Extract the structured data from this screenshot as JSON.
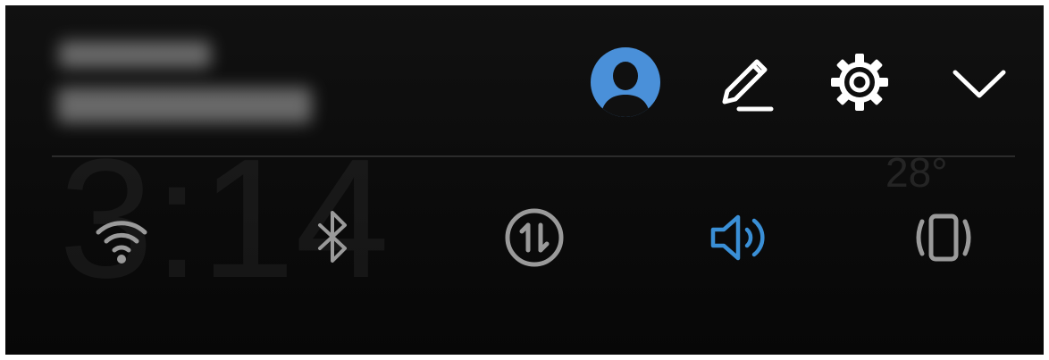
{
  "colors": {
    "panel_bg": "#0d0d0d",
    "icon_inactive": "#9a9a9a",
    "icon_header": "#ffffff",
    "accent_active": "#3a8fd6",
    "avatar_bg": "#4a90d9"
  },
  "header": {
    "notification_blurred": true,
    "actions": [
      {
        "name": "avatar",
        "icon": "user-avatar-icon"
      },
      {
        "name": "edit",
        "icon": "pencil-icon"
      },
      {
        "name": "settings",
        "icon": "gear-icon"
      },
      {
        "name": "collapse",
        "icon": "chevron-down-icon"
      }
    ]
  },
  "quick_toggles": [
    {
      "name": "wifi",
      "icon": "wifi-icon",
      "active": false
    },
    {
      "name": "bluetooth",
      "icon": "bluetooth-icon",
      "active": false
    },
    {
      "name": "mobile-data",
      "icon": "mobile-data-icon",
      "active": false
    },
    {
      "name": "sound",
      "icon": "speaker-icon",
      "active": true
    },
    {
      "name": "vibrate",
      "icon": "vibrate-icon",
      "active": false
    }
  ]
}
